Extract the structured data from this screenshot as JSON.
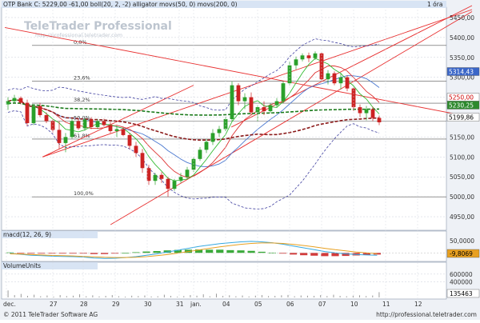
{
  "header": {
    "title": "OTP Bank C: 5229,00 -61,00 boll(20, 2, -2) alligator movs(50, 0) movs(200, 0)",
    "interval": "1 óra"
  },
  "watermark": {
    "brand": "TeleTrader Professional",
    "url": "http://professional.teletrader.com"
  },
  "fib_labels": [
    "0,0%",
    "23,6%",
    "38,2%",
    "50,0%",
    "61,8%",
    "100,0%"
  ],
  "price_axis": {
    "ticks": [
      "5450,00",
      "5400,00",
      "5350,00",
      "5300,00",
      "5250,00",
      "5200,00",
      "5150,00",
      "5100,00",
      "5050,00",
      "5000,00",
      "4950,00"
    ]
  },
  "price_tags": [
    {
      "label": "5314,43",
      "value": 5314.43,
      "color": "#3a66c8",
      "text_color": "#ffffff"
    },
    {
      "label": "5250,00",
      "value": 5250.0,
      "color": "#ffffff",
      "text_color": "#cc0000"
    },
    {
      "label": "5230,25",
      "value": 5230.25,
      "color": "#2d8a2d",
      "text_color": "#ffffff"
    },
    {
      "label": "5199,86",
      "value": 5199.86,
      "color": "#ffffff",
      "text_color": "#000000"
    }
  ],
  "macd": {
    "title": "macd(12, 26, 9)",
    "ticks": [
      "50,0000"
    ],
    "current_label": "-9,8069",
    "current_color": "#e8a020"
  },
  "volume": {
    "title": "VolumeUnits",
    "ticks": [
      "600000",
      "400000"
    ],
    "current_label": "135463"
  },
  "x_axis": {
    "labels": [
      "dec.",
      "27",
      "28",
      "29",
      "30",
      "31",
      "jan.",
      "04",
      "05",
      "06",
      "07",
      "10",
      "11",
      "12"
    ]
  },
  "footer": {
    "copyright": "© 2011 TeleTrader Software AG",
    "url": "http://professional.teletrader.com"
  },
  "colors": {
    "up_candle": "#2aa02a",
    "down_candle": "#cc2222",
    "bollinger": "#4040a0",
    "ma50": "#1a7a1a",
    "ma200": "#8b1a1a",
    "alligator_jaw": "#4a78d0",
    "alligator_teeth": "#dd3333",
    "alligator_lips": "#33bb33",
    "trendline": "#e83030"
  },
  "chart_data": [
    {
      "type": "candlestick",
      "title": "OTP Bank",
      "interval": "1 óra",
      "ylim": [
        4920,
        5470
      ],
      "x_categories": [
        "dec.",
        "27",
        "28",
        "29",
        "30",
        "31",
        "jan.",
        "04",
        "05",
        "06",
        "07",
        "10",
        "11",
        "12"
      ],
      "last_close": 5229.0,
      "change": -61.0,
      "candles": [
        {
          "o": 5232,
          "h": 5250,
          "l": 5218,
          "c": 5240
        },
        {
          "o": 5240,
          "h": 5256,
          "l": 5236,
          "c": 5248
        },
        {
          "o": 5248,
          "h": 5252,
          "l": 5232,
          "c": 5236
        },
        {
          "o": 5236,
          "h": 5244,
          "l": 5178,
          "c": 5185
        },
        {
          "o": 5185,
          "h": 5232,
          "l": 5180,
          "c": 5228
        },
        {
          "o": 5228,
          "h": 5236,
          "l": 5200,
          "c": 5205
        },
        {
          "o": 5205,
          "h": 5212,
          "l": 5185,
          "c": 5190
        },
        {
          "o": 5190,
          "h": 5196,
          "l": 5160,
          "c": 5168
        },
        {
          "o": 5168,
          "h": 5190,
          "l": 5120,
          "c": 5135
        },
        {
          "o": 5135,
          "h": 5160,
          "l": 5112,
          "c": 5150
        },
        {
          "o": 5150,
          "h": 5196,
          "l": 5146,
          "c": 5190
        },
        {
          "o": 5190,
          "h": 5198,
          "l": 5168,
          "c": 5172
        },
        {
          "o": 5172,
          "h": 5198,
          "l": 5166,
          "c": 5194
        },
        {
          "o": 5194,
          "h": 5200,
          "l": 5170,
          "c": 5175
        },
        {
          "o": 5175,
          "h": 5195,
          "l": 5170,
          "c": 5190
        },
        {
          "o": 5190,
          "h": 5196,
          "l": 5176,
          "c": 5180
        },
        {
          "o": 5180,
          "h": 5188,
          "l": 5160,
          "c": 5165
        },
        {
          "o": 5165,
          "h": 5178,
          "l": 5150,
          "c": 5170
        },
        {
          "o": 5170,
          "h": 5176,
          "l": 5152,
          "c": 5155
        },
        {
          "o": 5155,
          "h": 5160,
          "l": 5120,
          "c": 5128
        },
        {
          "o": 5128,
          "h": 5138,
          "l": 5100,
          "c": 5110
        },
        {
          "o": 5110,
          "h": 5120,
          "l": 5060,
          "c": 5072
        },
        {
          "o": 5072,
          "h": 5080,
          "l": 5030,
          "c": 5040
        },
        {
          "o": 5040,
          "h": 5060,
          "l": 5030,
          "c": 5055
        },
        {
          "o": 5055,
          "h": 5062,
          "l": 5035,
          "c": 5045
        },
        {
          "o": 5045,
          "h": 5050,
          "l": 5000,
          "c": 5020
        },
        {
          "o": 5020,
          "h": 5045,
          "l": 5015,
          "c": 5040
        },
        {
          "o": 5040,
          "h": 5060,
          "l": 5035,
          "c": 5050
        },
        {
          "o": 5050,
          "h": 5075,
          "l": 5045,
          "c": 5068
        },
        {
          "o": 5068,
          "h": 5100,
          "l": 5062,
          "c": 5095
        },
        {
          "o": 5095,
          "h": 5125,
          "l": 5090,
          "c": 5118
        },
        {
          "o": 5118,
          "h": 5145,
          "l": 5110,
          "c": 5138
        },
        {
          "o": 5138,
          "h": 5170,
          "l": 5130,
          "c": 5160
        },
        {
          "o": 5160,
          "h": 5178,
          "l": 5150,
          "c": 5170
        },
        {
          "o": 5170,
          "h": 5200,
          "l": 5165,
          "c": 5195
        },
        {
          "o": 5195,
          "h": 5290,
          "l": 5190,
          "c": 5280
        },
        {
          "o": 5280,
          "h": 5285,
          "l": 5230,
          "c": 5240
        },
        {
          "o": 5240,
          "h": 5260,
          "l": 5220,
          "c": 5250
        },
        {
          "o": 5250,
          "h": 5262,
          "l": 5205,
          "c": 5212
        },
        {
          "o": 5212,
          "h": 5230,
          "l": 5190,
          "c": 5225
        },
        {
          "o": 5225,
          "h": 5240,
          "l": 5205,
          "c": 5215
        },
        {
          "o": 5215,
          "h": 5235,
          "l": 5210,
          "c": 5230
        },
        {
          "o": 5230,
          "h": 5248,
          "l": 5225,
          "c": 5240
        },
        {
          "o": 5240,
          "h": 5290,
          "l": 5235,
          "c": 5285
        },
        {
          "o": 5285,
          "h": 5340,
          "l": 5280,
          "c": 5330
        },
        {
          "o": 5330,
          "h": 5352,
          "l": 5320,
          "c": 5345
        },
        {
          "o": 5345,
          "h": 5360,
          "l": 5340,
          "c": 5355
        },
        {
          "o": 5355,
          "h": 5362,
          "l": 5338,
          "c": 5348
        },
        {
          "o": 5348,
          "h": 5365,
          "l": 5344,
          "c": 5360
        },
        {
          "o": 5360,
          "h": 5362,
          "l": 5290,
          "c": 5295
        },
        {
          "o": 5295,
          "h": 5318,
          "l": 5282,
          "c": 5310
        },
        {
          "o": 5310,
          "h": 5315,
          "l": 5280,
          "c": 5285
        },
        {
          "o": 5285,
          "h": 5310,
          "l": 5270,
          "c": 5300
        },
        {
          "o": 5300,
          "h": 5305,
          "l": 5265,
          "c": 5272
        },
        {
          "o": 5272,
          "h": 5276,
          "l": 5215,
          "c": 5225
        },
        {
          "o": 5225,
          "h": 5232,
          "l": 5200,
          "c": 5210
        },
        {
          "o": 5210,
          "h": 5228,
          "l": 5192,
          "c": 5220
        },
        {
          "o": 5220,
          "h": 5226,
          "l": 5190,
          "c": 5198
        },
        {
          "o": 5198,
          "h": 5204,
          "l": 5180,
          "c": 5187
        }
      ],
      "series": [
        {
          "name": "boll(20, 2, -2)"
        },
        {
          "name": "alligator"
        },
        {
          "name": "movs(50, 0)"
        },
        {
          "name": "movs(200, 0)"
        }
      ],
      "fibonacci": [
        {
          "label": "0,0%",
          "value": 5380
        },
        {
          "label": "23,6%",
          "value": 5290
        },
        {
          "label": "38,2%",
          "value": 5235
        },
        {
          "label": "50,0%",
          "value": 5190
        },
        {
          "label": "61,8%",
          "value": 5145
        },
        {
          "label": "100,0%",
          "value": 5000
        }
      ]
    },
    {
      "type": "line",
      "title": "macd(12, 26, 9)",
      "ylim": [
        -30,
        60
      ],
      "last_value": -9.8069,
      "series": [
        {
          "name": "macd",
          "values": [
            -2,
            -6,
            -10,
            -12,
            -14,
            -15,
            -16,
            -18,
            -22,
            -24,
            -23,
            -20,
            -16,
            -10,
            -4,
            4,
            12,
            20,
            28,
            34,
            40,
            44,
            48,
            50,
            48,
            44,
            38,
            30,
            22,
            14,
            6,
            0,
            -4,
            -7,
            -9,
            -10
          ]
        },
        {
          "name": "signal",
          "values": [
            -4,
            -5,
            -7,
            -9,
            -11,
            -12,
            -13,
            -15,
            -17,
            -19,
            -20,
            -20,
            -19,
            -16,
            -12,
            -7,
            -1,
            6,
            13,
            20,
            26,
            32,
            37,
            41,
            43,
            43,
            41,
            37,
            32,
            26,
            20,
            14,
            9,
            4,
            0,
            -3
          ]
        }
      ],
      "histogram": [
        2,
        -1,
        -3,
        -3,
        -3,
        -3,
        -3,
        -3,
        -5,
        -5,
        -3,
        0,
        3,
        6,
        8,
        11,
        13,
        14,
        15,
        14,
        14,
        12,
        11,
        9,
        5,
        1,
        -3,
        -7,
        -10,
        -12,
        -14,
        -14,
        -13,
        -11,
        -9,
        -7
      ]
    },
    {
      "type": "bar",
      "title": "VolumeUnits",
      "ylim": [
        0,
        700000
      ],
      "last_value": 135463,
      "values": [
        180000,
        60000,
        90000,
        40000,
        70000,
        30000,
        50000,
        20000,
        60000,
        35000,
        45000,
        80000,
        30000,
        55000,
        25000,
        40000,
        60000,
        30000,
        20000,
        45000,
        35000,
        50000,
        25000,
        30000,
        70000,
        40000,
        20000,
        35000,
        60000,
        45000,
        80000,
        30000,
        95000,
        40000,
        55000,
        30000,
        50000,
        25000,
        45000,
        60000,
        35000,
        40000,
        55000,
        65000,
        30000,
        50000,
        45000,
        40000,
        60000,
        35000,
        70000,
        40000,
        30000,
        45000,
        55000,
        35000,
        50000,
        135463
      ]
    }
  ]
}
